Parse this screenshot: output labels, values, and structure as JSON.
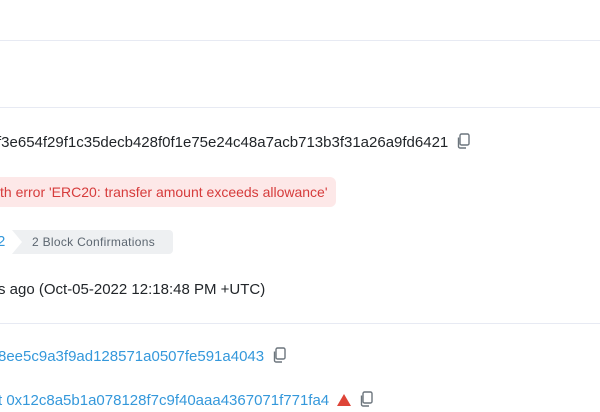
{
  "tx": {
    "hash_partial": "f3e654f29f1c35decb428f0f1e75e24c48a7acb713b3f31a26a9fd6421",
    "status_error": "th error 'ERC20: transfer amount exceeds allowance'",
    "block_number_partial": "2",
    "block_confirmations": "2 Block Confirmations",
    "timestamp_partial": "s ago (Oct-05-2022 12:18:48 PM +UTC)",
    "from_address_partial": "8ee5c9a3f9ad128571a0507fe591a4043",
    "to_address_partial": "t 0x12c8a5b1a078128f7c9f40aaa4367071f771fa4"
  },
  "colors": {
    "link": "#3498db",
    "error_text": "#d63b3b",
    "error_bg": "#fde8e8",
    "badge_bg": "#eef0f2",
    "divider": "#e7eaf3"
  },
  "icons": [
    "copy-icon",
    "warning-icon"
  ]
}
